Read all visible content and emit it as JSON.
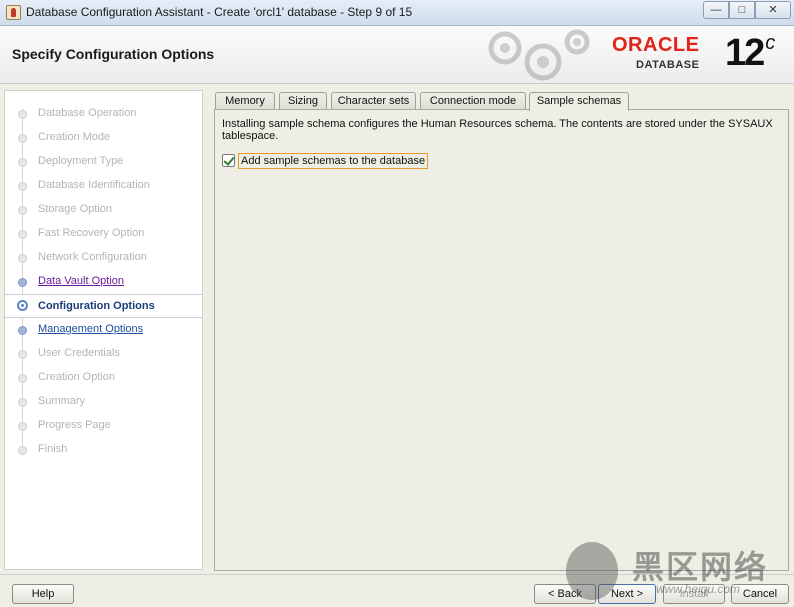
{
  "window": {
    "title": "Database Configuration Assistant - Create 'orcl1' database - Step 9 of 15",
    "controls": {
      "minimize": "—",
      "maximize": "□",
      "close": "✕"
    }
  },
  "header": {
    "page_title": "Specify Configuration Options",
    "brand": "ORACLE",
    "brand_sub": "DATABASE",
    "version": "12",
    "version_suffix": "c"
  },
  "nav": {
    "items": [
      {
        "label": "Database Operation",
        "state": "disabled"
      },
      {
        "label": "Creation Mode",
        "state": "disabled"
      },
      {
        "label": "Deployment Type",
        "state": "disabled"
      },
      {
        "label": "Database Identification",
        "state": "disabled"
      },
      {
        "label": "Storage Option",
        "state": "disabled"
      },
      {
        "label": "Fast Recovery Option",
        "state": "disabled"
      },
      {
        "label": "Network Configuration",
        "state": "disabled"
      },
      {
        "label": "Data Vault Option",
        "state": "visited"
      },
      {
        "label": "Configuration Options",
        "state": "current"
      },
      {
        "label": "Management Options",
        "state": "link"
      },
      {
        "label": "User Credentials",
        "state": "disabled"
      },
      {
        "label": "Creation Option",
        "state": "disabled"
      },
      {
        "label": "Summary",
        "state": "disabled"
      },
      {
        "label": "Progress Page",
        "state": "disabled"
      },
      {
        "label": "Finish",
        "state": "disabled"
      }
    ]
  },
  "tabs": [
    {
      "label": "Memory"
    },
    {
      "label": "Sizing"
    },
    {
      "label": "Character sets"
    },
    {
      "label": "Connection mode"
    },
    {
      "label": "Sample schemas"
    }
  ],
  "selected_tab": "Sample schemas",
  "sample_schemas": {
    "description": "Installing sample schema configures the Human Resources schema. The contents are stored under the SYSAUX tablespace.",
    "checkbox_label": "Add sample schemas to the database",
    "checked": true
  },
  "buttons": {
    "help": "Help",
    "back": "< Back",
    "next": "Next >",
    "install": "Install",
    "cancel": "Cancel"
  },
  "watermark": {
    "text": "黑区网络",
    "url": "www.heiqu.com"
  },
  "colors": {
    "brand_red": "#e2231a",
    "current_step": "#1a3d7a",
    "visited_link": "#6a1b9a",
    "link": "#1f4f9f",
    "focus_border": "#e39b2c"
  }
}
